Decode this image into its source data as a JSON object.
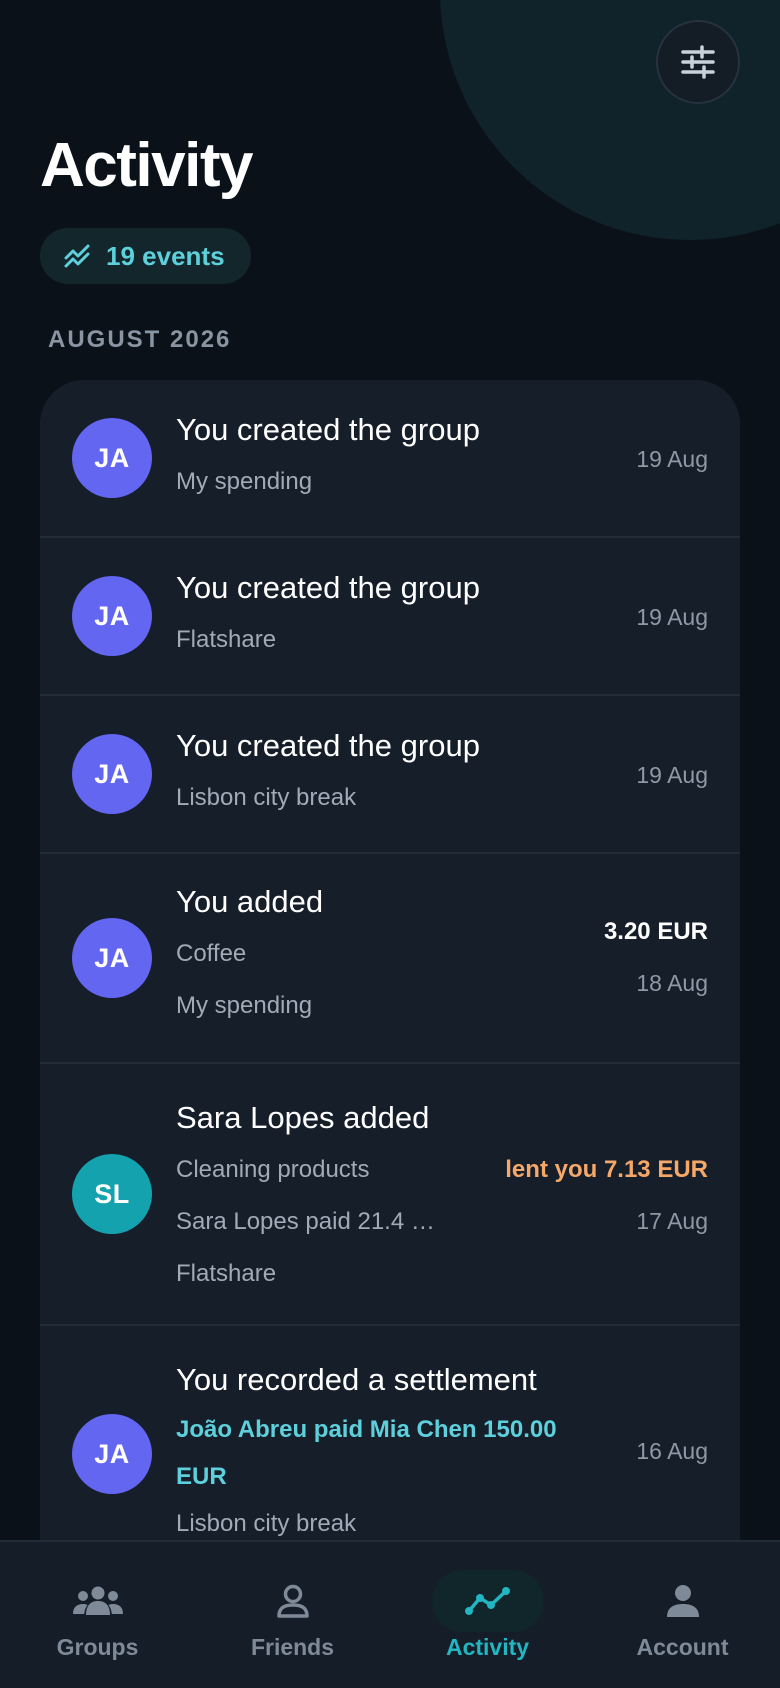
{
  "header": {
    "title": "Activity",
    "events_count": "19 events"
  },
  "section": {
    "label": "AUGUST 2026"
  },
  "activities": [
    {
      "avatar": "JA",
      "title": "You created the group",
      "subtitle": "My spending",
      "date": "19 Aug"
    },
    {
      "avatar": "JA",
      "title": "You created the group",
      "subtitle": "Flatshare",
      "date": "19 Aug"
    },
    {
      "avatar": "JA",
      "title": "You created the group",
      "subtitle": "Lisbon city break",
      "date": "19 Aug"
    },
    {
      "avatar": "JA",
      "title": "You added",
      "subtitle": "Coffee",
      "group": "My spending",
      "amount": "3.20 EUR",
      "date": "18 Aug"
    },
    {
      "avatar": "SL",
      "title": "Sara Lopes added",
      "subtitle": "Cleaning products",
      "detail": "Sara Lopes paid 21.4 …",
      "group": "Flatshare",
      "amount": "lent you 7.13 EUR",
      "date": "17 Aug"
    },
    {
      "avatar": "JA",
      "title": "You recorded a settlement",
      "detail": "João Abreu paid Mia Chen 150.00 EUR",
      "group": "Lisbon city break",
      "date": "16 Aug"
    }
  ],
  "nav": {
    "items": [
      {
        "label": "Groups",
        "icon": "groups-icon"
      },
      {
        "label": "Friends",
        "icon": "friend-icon"
      },
      {
        "label": "Activity",
        "icon": "activity-icon",
        "active": true
      },
      {
        "label": "Account",
        "icon": "account-icon"
      }
    ]
  },
  "colors": {
    "background": "#0b1119",
    "card": "#161e2a",
    "accent_teal": "#22b5c2",
    "avatar_ja": "#6366f1",
    "avatar_sl": "#14a3ae",
    "lent_orange": "#f5a868"
  }
}
